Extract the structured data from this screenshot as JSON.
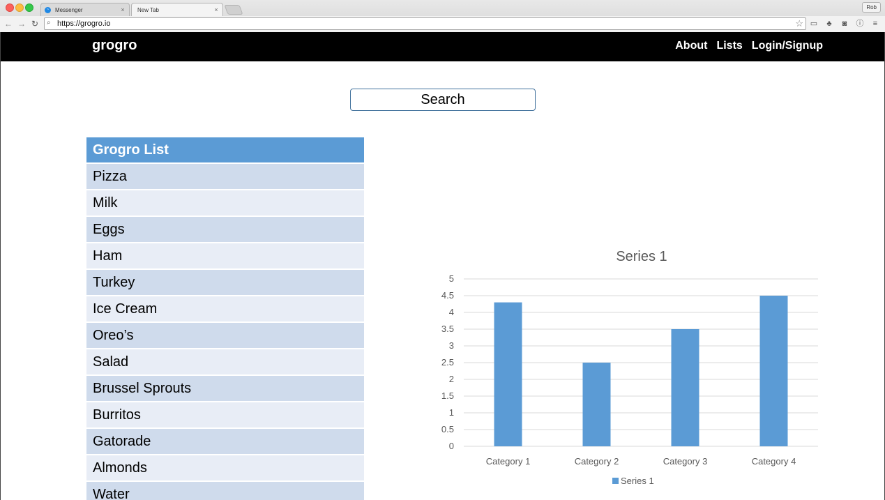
{
  "browser": {
    "tabs": [
      {
        "title": "Messenger",
        "close": "×"
      },
      {
        "title": "New Tab",
        "close": "×"
      }
    ],
    "profile_name": "Rob",
    "url": "https://grogro.io"
  },
  "navbar": {
    "brand": "grogro",
    "links": [
      "About",
      "Lists",
      "Login/Signup"
    ]
  },
  "search": {
    "label": "Search"
  },
  "list": {
    "title": "Grogro List",
    "items": [
      "Pizza",
      "Milk",
      "Eggs",
      "Ham",
      "Turkey",
      "Ice Cream",
      "Oreo’s",
      "Salad",
      "Brussel Sprouts",
      "Burritos",
      "Gatorade",
      "Almonds",
      "Water"
    ]
  },
  "chart_data": {
    "type": "bar",
    "title": "Series 1",
    "categories": [
      "Category 1",
      "Category 2",
      "Category 3",
      "Category 4"
    ],
    "series": [
      {
        "name": "Series 1",
        "values": [
          4.3,
          2.5,
          3.5,
          4.5
        ],
        "color": "#5b9bd5"
      }
    ],
    "ylim": [
      0,
      5
    ],
    "yticks": [
      "0",
      "0.5",
      "1",
      "1.5",
      "2",
      "2.5",
      "3",
      "3.5",
      "4",
      "4.5",
      "5"
    ],
    "grid": true,
    "legend": "bottom"
  }
}
